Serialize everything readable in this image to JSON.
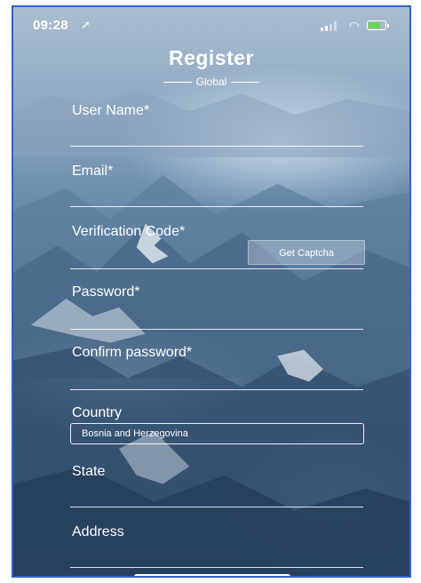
{
  "status_bar": {
    "time": "09:28",
    "location_icon": "location-arrow-icon",
    "wifi_icon": "wifi-icon",
    "battery_icon": "battery-charging-icon"
  },
  "header": {
    "title": "Register",
    "subtitle": "Global"
  },
  "form": {
    "user_name_label": "User Name*",
    "email_label": "Email*",
    "verification_label": "Verification Code*",
    "captcha_button": "Get Captcha",
    "password_label": "Password*",
    "confirm_password_label": "Confirm password*",
    "country_label": "Country",
    "country_value": "Bosnia and Herzegovina",
    "state_label": "State",
    "address_label": "Address"
  },
  "colors": {
    "frame_border": "#2f5fd0",
    "battery_fill": "#6cd35a",
    "text": "#ffffff"
  }
}
